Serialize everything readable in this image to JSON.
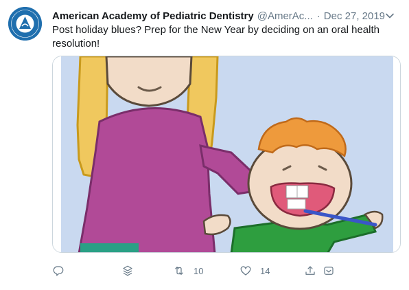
{
  "tweet": {
    "author_name": "American Academy of Pediatric Dentistry",
    "handle": "@AmerAc...",
    "separator": "·",
    "date": "Dec 27, 2019",
    "text": "Post holiday blues? Prep for the New Year by deciding on an oral health resolution!",
    "logo_text": "AMERICAN ACADEMY OF PEDIATRIC DENTISTRY"
  },
  "actions": {
    "retweet_count": "10",
    "like_count": "14"
  },
  "icons": {
    "menu": "chevron-down-icon",
    "reply": "reply-icon",
    "stack": "layers-icon",
    "retweet": "retweet-icon",
    "like": "heart-icon",
    "share": "share-icon",
    "tip": "tip-jar-icon"
  },
  "colors": {
    "text": "#14171a",
    "secondary": "#657786",
    "border": "#ccd6dd",
    "brand_blue": "#1f6fae",
    "illustration_bg": "#c9d9f0"
  }
}
